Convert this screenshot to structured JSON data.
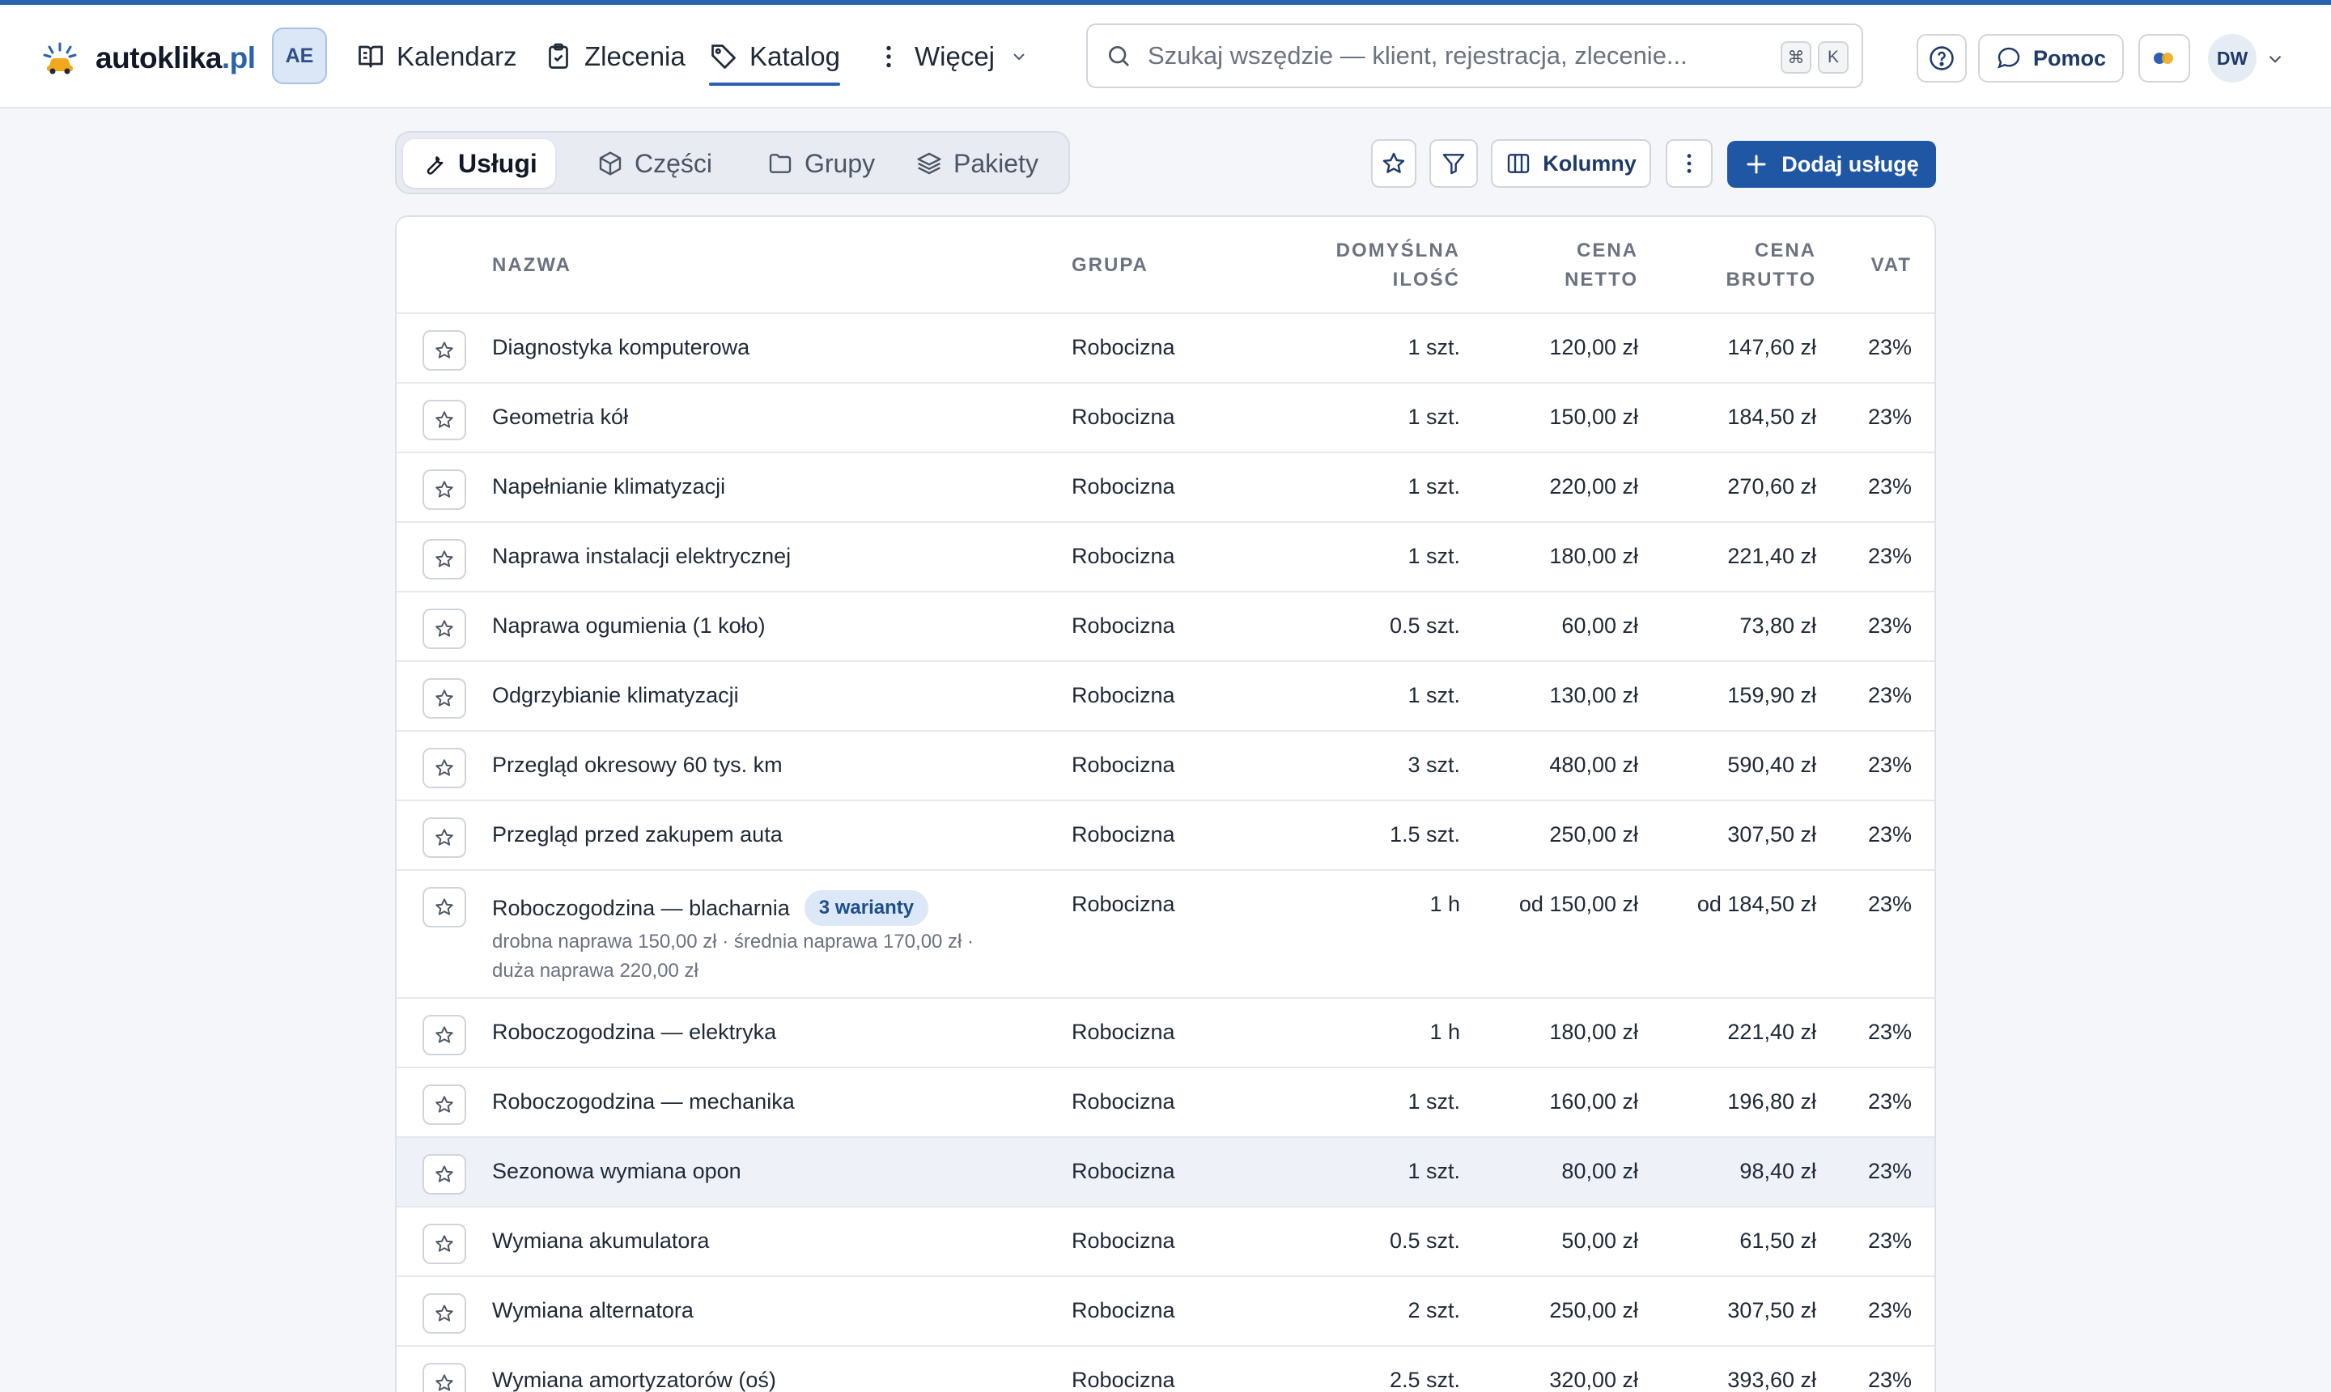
{
  "app": {
    "logo_main": "autoklika",
    "logo_tld": ".pl",
    "workspace_badge": "AE",
    "brand_color": "#2b62b0"
  },
  "nav": {
    "items": [
      {
        "label": "Kalendarz",
        "icon": "book-open-icon"
      },
      {
        "label": "Zlecenia",
        "icon": "clipboard-icon"
      },
      {
        "label": "Katalog",
        "icon": "tag-icon",
        "active": true
      },
      {
        "label": "Więcej",
        "icon": "more-vertical-icon"
      }
    ]
  },
  "search": {
    "placeholder": "Szukaj wszędzie — klient, rejestracja, zlecenie...",
    "kbd_modifier": "⌘",
    "kbd_key": "K"
  },
  "header_actions": {
    "help_icon": "help-circle-icon",
    "pomoc_label": "Pomoc",
    "user_initials": "DW"
  },
  "tabs": [
    {
      "label": "Usługi",
      "icon": "wrench-icon",
      "active": true
    },
    {
      "label": "Części",
      "icon": "box-icon"
    },
    {
      "label": "Grupy",
      "icon": "folder-icon"
    },
    {
      "label": "Pakiety",
      "icon": "layers-icon"
    }
  ],
  "toolbar": {
    "columns_label": "Kolumny",
    "add_label": "Dodaj usługę"
  },
  "table": {
    "headers": {
      "name": "NAZWA",
      "group": "GRUPA",
      "qty_1": "DOMYŚLNA",
      "qty_2": "ILOŚĆ",
      "net_1": "CENA",
      "net_2": "NETTO",
      "gross_1": "CENA",
      "gross_2": "BRUTTO",
      "vat": "VAT"
    },
    "rows": [
      {
        "name": "Diagnostyka komputerowa",
        "group": "Robocizna",
        "qty": "1 szt.",
        "net": "120,00 zł",
        "gross": "147,60 zł",
        "vat": "23%"
      },
      {
        "name": "Geometria kół",
        "group": "Robocizna",
        "qty": "1 szt.",
        "net": "150,00 zł",
        "gross": "184,50 zł",
        "vat": "23%"
      },
      {
        "name": "Napełnianie klimatyzacji",
        "group": "Robocizna",
        "qty": "1 szt.",
        "net": "220,00 zł",
        "gross": "270,60 zł",
        "vat": "23%"
      },
      {
        "name": "Naprawa instalacji elektrycznej",
        "group": "Robocizna",
        "qty": "1 szt.",
        "net": "180,00 zł",
        "gross": "221,40 zł",
        "vat": "23%"
      },
      {
        "name": "Naprawa ogumienia (1 koło)",
        "group": "Robocizna",
        "qty": "0.5 szt.",
        "net": "60,00 zł",
        "gross": "73,80 zł",
        "vat": "23%"
      },
      {
        "name": "Odgrzybianie klimatyzacji",
        "group": "Robocizna",
        "qty": "1 szt.",
        "net": "130,00 zł",
        "gross": "159,90 zł",
        "vat": "23%"
      },
      {
        "name": "Przegląd okresowy 60 tys. km",
        "group": "Robocizna",
        "qty": "3 szt.",
        "net": "480,00 zł",
        "gross": "590,40 zł",
        "vat": "23%"
      },
      {
        "name": "Przegląd przed zakupem auta",
        "group": "Robocizna",
        "qty": "1.5 szt.",
        "net": "250,00 zł",
        "gross": "307,50 zł",
        "vat": "23%"
      },
      {
        "name": "Roboczogodzina — blacharnia",
        "badge": "3 warianty",
        "desc_1": "drobna naprawa 150,00 zł · średnia naprawa 170,00 zł ·",
        "desc_2": "duża naprawa 220,00 zł",
        "group": "Robocizna",
        "qty": "1 h",
        "net": "od 150,00 zł",
        "gross": "od 184,50 zł",
        "vat": "23%"
      },
      {
        "name": "Roboczogodzina — elektryka",
        "group": "Robocizna",
        "qty": "1 h",
        "net": "180,00 zł",
        "gross": "221,40 zł",
        "vat": "23%"
      },
      {
        "name": "Roboczogodzina — mechanika",
        "group": "Robocizna",
        "qty": "1 szt.",
        "net": "160,00 zł",
        "gross": "196,80 zł",
        "vat": "23%"
      },
      {
        "name": "Sezonowa wymiana opon",
        "group": "Robocizna",
        "qty": "1 szt.",
        "net": "80,00 zł",
        "gross": "98,40 zł",
        "vat": "23%",
        "highlighted": true
      },
      {
        "name": "Wymiana akumulatora",
        "group": "Robocizna",
        "qty": "0.5 szt.",
        "net": "50,00 zł",
        "gross": "61,50 zł",
        "vat": "23%"
      },
      {
        "name": "Wymiana alternatora",
        "group": "Robocizna",
        "qty": "2 szt.",
        "net": "250,00 zł",
        "gross": "307,50 zł",
        "vat": "23%"
      },
      {
        "name": "Wymiana amortyzatorów (oś)",
        "group": "Robocizna",
        "qty": "2.5 szt.",
        "net": "320,00 zł",
        "gross": "393,60 zł",
        "vat": "23%"
      }
    ]
  }
}
